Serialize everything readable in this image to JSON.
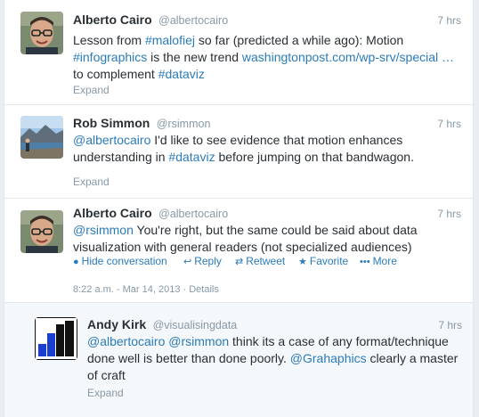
{
  "tweets": [
    {
      "name": "Alberto Cairo",
      "handle": "@albertocairo",
      "time": "7 hrs",
      "text_parts": [
        {
          "t": "Lesson from ",
          "link": false
        },
        {
          "t": "#malofiej",
          "link": true
        },
        {
          "t": " so far (predicted a while ago): Motion ",
          "link": false
        },
        {
          "t": "#infographics",
          "link": true
        },
        {
          "t": " is the new trend ",
          "link": false
        },
        {
          "t": "washingtonpost.com/wp-srv/special …",
          "link": true
        },
        {
          "t": " to complement ",
          "link": false
        },
        {
          "t": "#dataviz",
          "link": true
        }
      ],
      "expand": "Expand",
      "avatar_icon": "portrait-man-glasses-icon"
    },
    {
      "name": "Rob Simmon",
      "handle": "@rsimmon",
      "time": "7 hrs",
      "text_parts": [
        {
          "t": "@albertocairo",
          "link": true
        },
        {
          "t": " I'd like to see evidence that motion enhances understanding in ",
          "link": false
        },
        {
          "t": "#dataviz",
          "link": true
        },
        {
          "t": " before jumping on that bandwagon.",
          "link": false
        }
      ],
      "expand": "Expand",
      "avatar_icon": "landscape-photo-icon"
    },
    {
      "name": "Alberto Cairo",
      "handle": "@albertocairo",
      "time": "7 hrs",
      "text_parts": [
        {
          "t": "@rsimmon",
          "link": true
        },
        {
          "t": " You're right, but the same could be said about data visualization with general readers (not specialized audiences)",
          "link": false
        }
      ],
      "actions": {
        "hide": "Hide conversation",
        "reply": "Reply",
        "retweet": "Retweet",
        "favorite": "Favorite",
        "more": "More"
      },
      "meta": "8:22 a.m. - Mar 14, 2013 · Details",
      "avatar_icon": "portrait-man-glasses-icon"
    },
    {
      "name": "Andy Kirk",
      "handle": "@visualisingdata",
      "time": "7 hrs",
      "text_parts": [
        {
          "t": "@albertocairo",
          "link": true
        },
        {
          "t": " ",
          "link": false
        },
        {
          "t": "@rsimmon",
          "link": true
        },
        {
          "t": " think its a case of any format/technique done well is better than done poorly. ",
          "link": false
        },
        {
          "t": "@Grahaphics",
          "link": true
        },
        {
          "t": " clearly a master of craft",
          "link": false
        }
      ],
      "expand": "Expand",
      "avatar_icon": "bar-chart-logo-icon"
    }
  ],
  "colors": {
    "link": "#2b7bb9",
    "muted": "#8899a6",
    "text": "#292f33"
  }
}
